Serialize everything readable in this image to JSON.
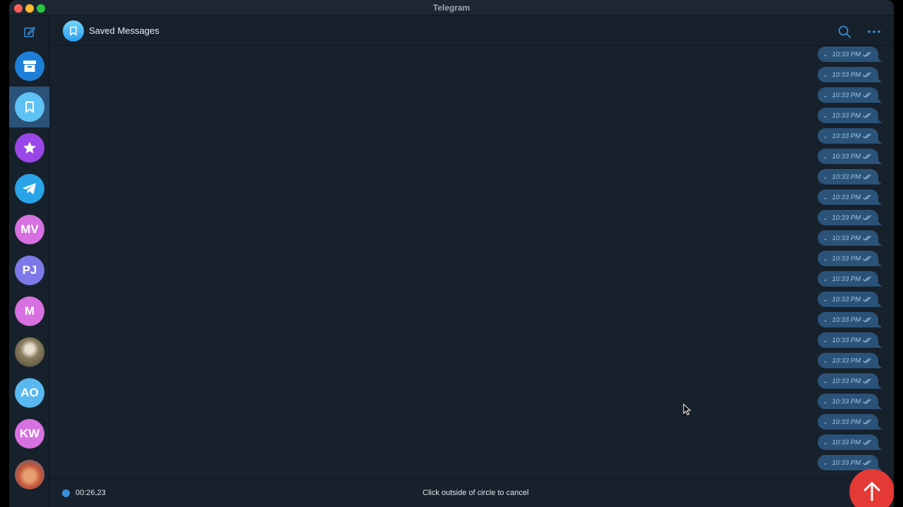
{
  "window": {
    "title": "Telegram"
  },
  "sidebar": {
    "compose_icon": "compose-icon",
    "chats": [
      {
        "name": "archive",
        "initials": "",
        "icon": "archive-icon",
        "color": "#1d7fd8"
      },
      {
        "name": "saved-messages",
        "initials": "",
        "icon": "bookmark-icon",
        "color": "#5fc2f5"
      },
      {
        "name": "starred",
        "initials": "",
        "icon": "star-icon",
        "color": "#9b46e8"
      },
      {
        "name": "telegram",
        "initials": "",
        "icon": "telegram-plane-icon",
        "color": "#2aa4e8"
      },
      {
        "name": "mv",
        "initials": "MV",
        "icon": "",
        "color": "#d770e0"
      },
      {
        "name": "pj",
        "initials": "PJ",
        "icon": "",
        "color": "#7e79e8"
      },
      {
        "name": "m",
        "initials": "M",
        "icon": "",
        "color": "#d770e0"
      },
      {
        "name": "photo-avatar-1",
        "initials": "",
        "icon": "photo-avatar",
        "color": "#6b6248"
      },
      {
        "name": "ao",
        "initials": "AO",
        "icon": "",
        "color": "#5ab8f0"
      },
      {
        "name": "kw",
        "initials": "KW",
        "icon": "",
        "color": "#d770e0"
      },
      {
        "name": "photo-avatar-2",
        "initials": "",
        "icon": "photo-avatar",
        "color": "#c8704a"
      }
    ]
  },
  "header": {
    "title": "Saved Messages",
    "search_icon": "search-icon",
    "more_icon": "more-icon"
  },
  "messages": [
    {
      "time": "10:33 PM"
    },
    {
      "time": "10:33 PM"
    },
    {
      "time": "10:33 PM"
    },
    {
      "time": "10:33 PM"
    },
    {
      "time": "10:33 PM"
    },
    {
      "time": "10:33 PM"
    },
    {
      "time": "10:33 PM"
    },
    {
      "time": "10:33 PM"
    },
    {
      "time": "10:33 PM"
    },
    {
      "time": "10:33 PM"
    },
    {
      "time": "10:33 PM"
    },
    {
      "time": "10:33 PM"
    },
    {
      "time": "10:33 PM"
    },
    {
      "time": "10:33 PM"
    },
    {
      "time": "10:33 PM"
    },
    {
      "time": "10:33 PM"
    },
    {
      "time": "10:33 PM"
    },
    {
      "time": "10:33 PM"
    },
    {
      "time": "10:33 PM"
    },
    {
      "time": "10:33 PM"
    },
    {
      "time": "10:33 PM"
    }
  ],
  "recording": {
    "elapsed": "00:26,23",
    "hint": "Click outside of circle to cancel",
    "send_icon": "arrow-up-icon"
  },
  "colors": {
    "background": "#17212b",
    "bubble": "#2b5278",
    "accent": "#3a8fd8",
    "record_button": "#e53935"
  }
}
